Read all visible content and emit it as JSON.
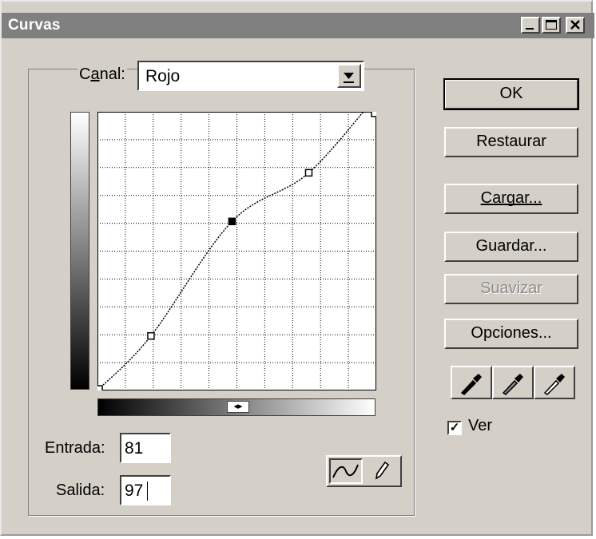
{
  "window": {
    "title": "Curvas",
    "minimize_glyph": "_",
    "maximize_glyph": "□",
    "close_glyph": "×"
  },
  "channel": {
    "label": "Canal:",
    "value": "Rojo"
  },
  "inputs": {
    "entrada_label": "Entrada:",
    "entrada_value": "81",
    "salida_label": "Salida:",
    "salida_value": "97"
  },
  "buttons": {
    "ok": "OK",
    "restaurar": "Restaurar",
    "cargar": "Cargar...",
    "guardar": "Guardar...",
    "suavizar": "Suavizar",
    "opciones": "Opciones..."
  },
  "preview": {
    "label": "Ver",
    "checked": true
  },
  "icons": {
    "eyedroppers": [
      "black-eyedropper-icon",
      "gray-eyedropper-icon",
      "white-eyedropper-icon"
    ],
    "curve_tools": [
      "curve-point-tool-icon",
      "pencil-tool-icon"
    ],
    "gradient_toggle": "gradient-direction-toggle-icon"
  },
  "curve": {
    "points": [
      [
        0,
        0
      ],
      [
        48,
        49
      ],
      [
        123,
        155
      ],
      [
        194,
        200
      ],
      [
        264,
        279
      ],
      [
        255,
        255
      ]
    ],
    "selected_point": [
      123,
      155
    ]
  }
}
